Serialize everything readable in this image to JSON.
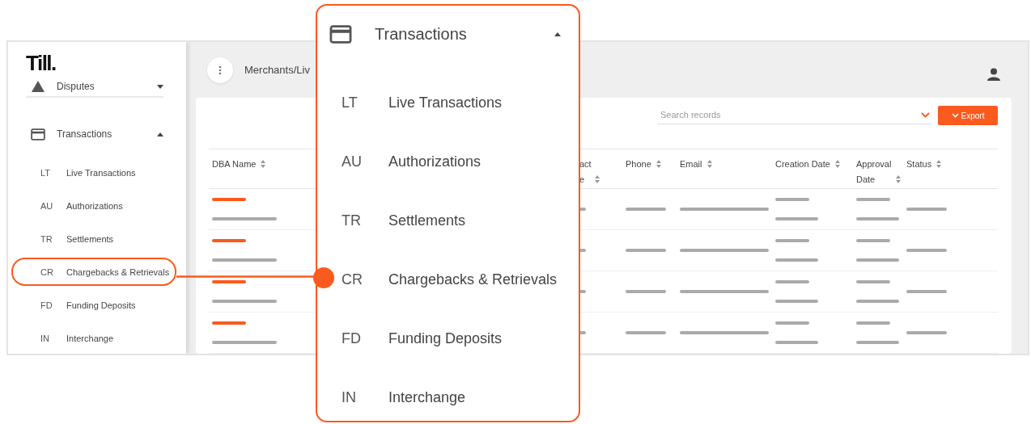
{
  "sidebar": {
    "logo": "Till.",
    "sections": [
      {
        "label": "Disputes",
        "expanded": false
      },
      {
        "label": "Transactions",
        "expanded": true
      }
    ],
    "items": [
      {
        "abbr": "LT",
        "label": "Live Transactions",
        "highlighted": false
      },
      {
        "abbr": "AU",
        "label": "Authorizations",
        "highlighted": false
      },
      {
        "abbr": "TR",
        "label": "Settlements",
        "highlighted": false
      },
      {
        "abbr": "CR",
        "label": "Chargebacks & Retrievals",
        "highlighted": true
      },
      {
        "abbr": "FD",
        "label": "Funding Deposits",
        "highlighted": false
      },
      {
        "abbr": "IN",
        "label": "Interchange",
        "highlighted": false
      }
    ]
  },
  "breadcrumb": "Merchants/Liv",
  "search": {
    "placeholder": "Search records"
  },
  "export_button": "Export",
  "table": {
    "columns": [
      {
        "label": "DBA Name",
        "kind": "sort"
      },
      {
        "kind": "hidden"
      },
      {
        "label": "act e",
        "kind": "fragment"
      },
      {
        "label": "Phone",
        "kind": "sort"
      },
      {
        "label": "Email",
        "kind": "sort"
      },
      {
        "label": "Creation Date",
        "kind": "sort"
      },
      {
        "label": "Approval Date",
        "kind": "sort"
      },
      {
        "label": "Status",
        "kind": "sort"
      }
    ],
    "rows": [
      {
        "kind": "placeholder"
      },
      {
        "kind": "placeholder"
      },
      {
        "kind": "placeholder"
      },
      {
        "kind": "placeholder"
      }
    ]
  },
  "callout": {
    "title": "Transactions",
    "expanded": true,
    "items": [
      {
        "abbr": "LT",
        "label": "Live Transactions",
        "highlighted": false
      },
      {
        "abbr": "AU",
        "label": "Authorizations",
        "highlighted": false
      },
      {
        "abbr": "TR",
        "label": "Settlements",
        "highlighted": false
      },
      {
        "abbr": "CR",
        "label": "Chargebacks & Retrievals",
        "highlighted": true
      },
      {
        "abbr": "FD",
        "label": "Funding Deposits",
        "highlighted": false
      },
      {
        "abbr": "IN",
        "label": "Interchange",
        "highlighted": false
      }
    ]
  }
}
